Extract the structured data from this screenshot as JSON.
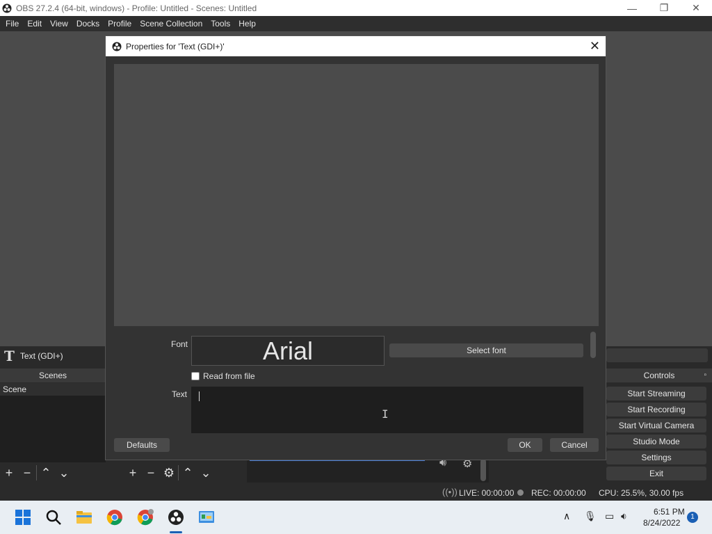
{
  "window": {
    "title": "OBS 27.2.4 (64-bit, windows) - Profile: Untitled - Scenes: Untitled",
    "minimize": "—",
    "maximize": "❐",
    "close": "✕"
  },
  "menu": [
    "File",
    "Edit",
    "View",
    "Docks",
    "Profile",
    "Scene Collection",
    "Tools",
    "Help"
  ],
  "source_bar": {
    "icon_glyph": "T",
    "source_name": "Text (GDI+)"
  },
  "scenes_dock": {
    "header": "Scenes",
    "items": [
      "Scene"
    ]
  },
  "controls_dock": {
    "header": "Controls",
    "buttons": [
      "Start Streaming",
      "Start Recording",
      "Start Virtual Camera",
      "Studio Mode",
      "Settings",
      "Exit"
    ]
  },
  "status": {
    "live": "LIVE: 00:00:00",
    "rec": "REC: 00:00:00",
    "cpu": "CPU: 25.5%, 30.00 fps"
  },
  "clock": {
    "time": "6:51 PM",
    "date": "8/24/2022"
  },
  "notifications_count": "1",
  "dialog": {
    "title": "Properties for 'Text (GDI+)'",
    "close": "✕",
    "font_label": "Font",
    "font_value": "Arial",
    "select_font": "Select font",
    "read_from_file": "Read from file",
    "read_from_file_checked": false,
    "text_label": "Text",
    "text_value": "",
    "defaults": "Defaults",
    "ok": "OK",
    "cancel": "Cancel"
  },
  "colors": {
    "accent": "#1a5fb4",
    "panel": "#3a3a3a",
    "dialog_bg": "#333333"
  }
}
